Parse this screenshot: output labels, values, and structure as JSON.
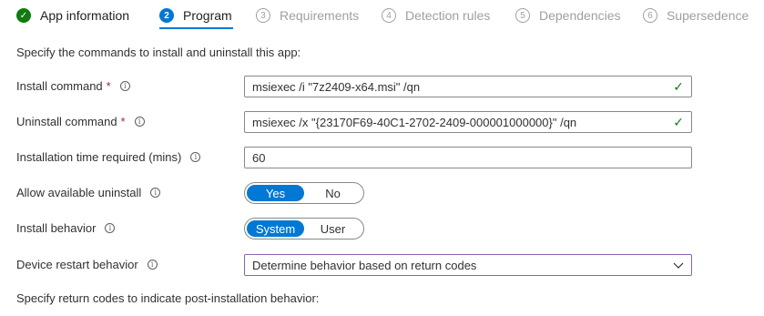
{
  "steps": [
    {
      "number": "✓",
      "label": "App information",
      "state": "done"
    },
    {
      "number": "2",
      "label": "Program",
      "state": "active"
    },
    {
      "number": "3",
      "label": "Requirements",
      "state": "pending"
    },
    {
      "number": "4",
      "label": "Detection rules",
      "state": "pending"
    },
    {
      "number": "5",
      "label": "Dependencies",
      "state": "pending"
    },
    {
      "number": "6",
      "label": "Supersedence",
      "state": "pending"
    }
  ],
  "intro": "Specify the commands to install and uninstall this app:",
  "form": {
    "install_command": {
      "label": "Install command",
      "required": "*",
      "value": "msiexec /i \"7z2409-x64.msi\" /qn"
    },
    "uninstall_command": {
      "label": "Uninstall command",
      "required": "*",
      "value": "msiexec /x \"{23170F69-40C1-2702-2409-000001000000}\" /qn"
    },
    "install_time": {
      "label": "Installation time required (mins)",
      "value": "60"
    },
    "allow_uninstall": {
      "label": "Allow available uninstall",
      "options": [
        "Yes",
        "No"
      ],
      "selected": "Yes"
    },
    "install_behavior": {
      "label": "Install behavior",
      "options": [
        "System",
        "User"
      ],
      "selected": "System"
    },
    "restart_behavior": {
      "label": "Device restart behavior",
      "value": "Determine behavior based on return codes"
    }
  },
  "footer": "Specify return codes to indicate post-installation behavior:",
  "colors": {
    "accent": "#0078d4",
    "success": "#107c10",
    "required": "#a4262c",
    "select_border": "#8764b8"
  },
  "icons": {
    "info": "info-icon",
    "check": "checkmark-icon",
    "chevron": "chevron-down-icon"
  }
}
